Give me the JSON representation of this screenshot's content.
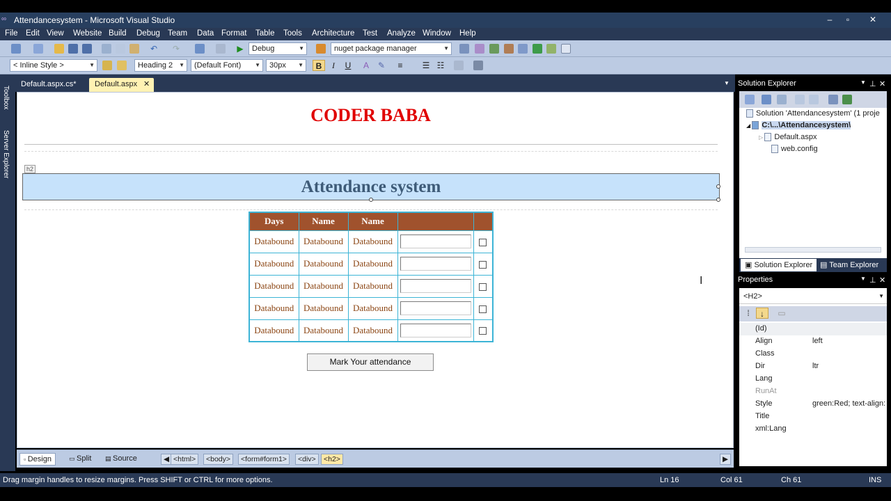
{
  "window": {
    "title": "Attendancesystem - Microsoft Visual Studio"
  },
  "menu": [
    "File",
    "Edit",
    "View",
    "Website",
    "Build",
    "Debug",
    "Team",
    "Data",
    "Format",
    "Table",
    "Tools",
    "Architecture",
    "Test",
    "Analyze",
    "Window",
    "Help"
  ],
  "toolbar1": {
    "config": "Debug",
    "search": "nuget package manager"
  },
  "toolbar2": {
    "style": "< Inline Style >",
    "block": "Heading 2",
    "font": "(Default Font)",
    "size": "30px",
    "bold": "B",
    "italic": "I",
    "underline": "U"
  },
  "leftrail": {
    "toolbox": "Toolbox",
    "server_explorer": "Server Explorer"
  },
  "tabs": [
    {
      "label": "Default.aspx.cs*"
    },
    {
      "label": "Default.aspx"
    }
  ],
  "page": {
    "brand": "CODER BABA",
    "h2_tag": "h2",
    "heading": "Attendance system",
    "grid_headers": [
      "Days",
      "Name",
      "Name",
      "",
      ""
    ],
    "grid_rows": [
      [
        "Databound",
        "Databound",
        "Databound"
      ],
      [
        "Databound",
        "Databound",
        "Databound"
      ],
      [
        "Databound",
        "Databound",
        "Databound"
      ],
      [
        "Databound",
        "Databound",
        "Databound"
      ],
      [
        "Databound",
        "Databound",
        "Databound"
      ]
    ],
    "button": "Mark Your attendance"
  },
  "viewbar": {
    "design": "Design",
    "split": "Split",
    "source": "Source",
    "breadcrumbs": [
      "<html>",
      "<body>",
      "<form#form1>",
      "<div>",
      "<h2>"
    ]
  },
  "solution_explorer": {
    "title": "Solution Explorer",
    "solution": "Solution 'Attendancesystem' (1 proje",
    "project": "C:\\...\\Attendancesystem\\",
    "files": [
      "Default.aspx",
      "web.config"
    ],
    "tab_active": "Solution Explorer",
    "tab_other": "Team Explorer"
  },
  "properties": {
    "title": "Properties",
    "selected": "<H2>",
    "rows": [
      {
        "name": "(Id)",
        "value": ""
      },
      {
        "name": "Align",
        "value": "left"
      },
      {
        "name": "Class",
        "value": ""
      },
      {
        "name": "Dir",
        "value": "ltr"
      },
      {
        "name": "Lang",
        "value": ""
      },
      {
        "name": "RunAt",
        "value": ""
      },
      {
        "name": "Style",
        "value": "green:Red; text-align:"
      },
      {
        "name": "Title",
        "value": ""
      },
      {
        "name": "xml:Lang",
        "value": ""
      }
    ]
  },
  "status": {
    "message": "Drag margin handles to resize margins. Press SHIFT or CTRL for more options.",
    "ln": "Ln 16",
    "col": "Col 61",
    "ch": "Ch 61",
    "mode": "INS"
  },
  "colors": {
    "brand": "#e00000",
    "grid_header": "#a0522d",
    "grid_border": "#3cb4d6",
    "h2_bg": "#c6e2fb",
    "chrome": "#293955"
  }
}
